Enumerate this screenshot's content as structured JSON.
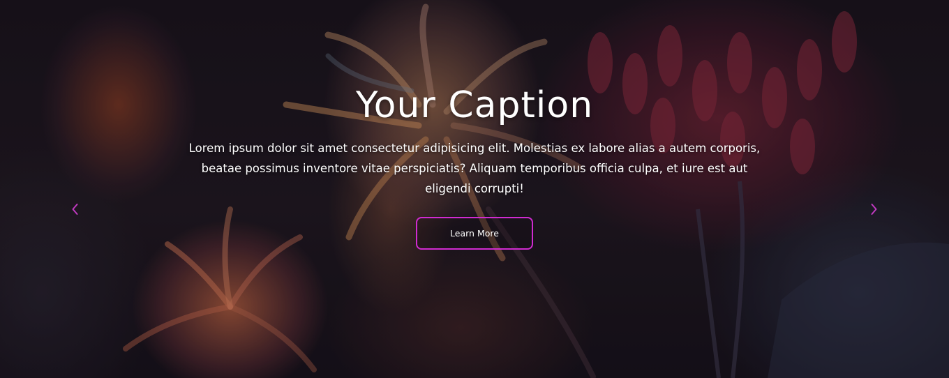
{
  "hero": {
    "title": "Your Caption",
    "description": "Lorem ipsum dolor sit amet consectetur adipisicing elit. Molestias ex labore alias a autem corporis, beatae possimus inventore vitae perspiciatis? Aliquam temporibus officia culpa, et iure est aut eligendi corrupti!",
    "button_label": "Learn More"
  },
  "carousel": {
    "prev_icon": "chevron-left-icon",
    "next_icon": "chevron-right-icon"
  },
  "colors": {
    "accent": "#d02bd0",
    "text": "#ffffff",
    "background": "#1a141c"
  }
}
